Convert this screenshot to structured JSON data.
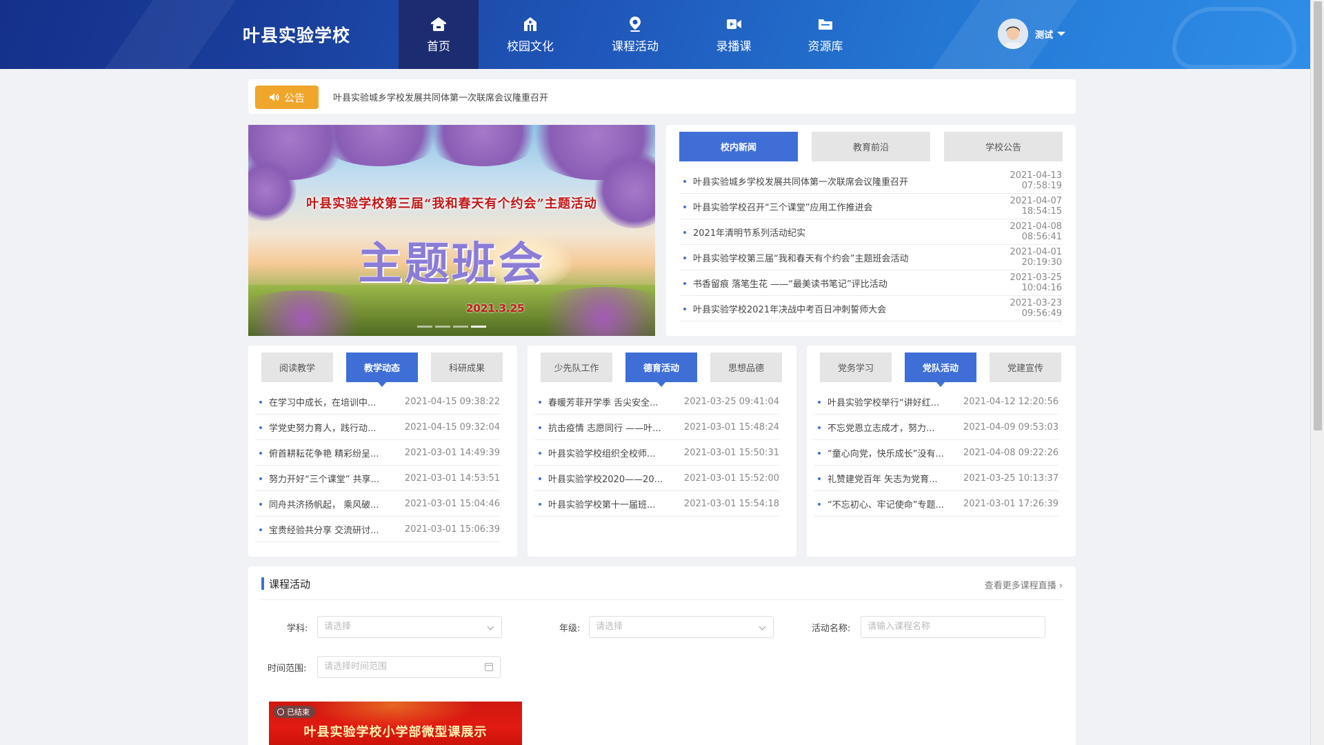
{
  "header": {
    "brand": "叶县实验学校",
    "user_name": "测试",
    "nav": [
      {
        "label": "首页",
        "icon": "home-icon",
        "active": true
      },
      {
        "label": "校园文化",
        "icon": "school-icon",
        "active": false
      },
      {
        "label": "课程活动",
        "icon": "location-pin-icon",
        "active": false
      },
      {
        "label": "录播课",
        "icon": "video-camera-icon",
        "active": false
      },
      {
        "label": "资源库",
        "icon": "folder-icon",
        "active": false
      }
    ]
  },
  "notice": {
    "badge": "公告",
    "text": "叶县实验城乡学校发展共同体第一次联席会议隆重召开"
  },
  "banner": {
    "title": "叶县实验学校第三届“我和春天有个约会”主题活动",
    "main": "主题班会",
    "date": "2021.3.25"
  },
  "news": {
    "tabs": [
      "校内新闻",
      "教育前沿",
      "学校公告"
    ],
    "items": [
      {
        "title": "叶县实验城乡学校发展共同体第一次联席会议隆重召开",
        "date": "2021-04-13 07:58:19"
      },
      {
        "title": "叶县实验学校召开“三个课堂”应用工作推进会",
        "date": "2021-04-07 18:54:15"
      },
      {
        "title": "2021年清明节系列活动纪实",
        "date": "2021-04-08 08:56:41"
      },
      {
        "title": "叶县实验学校第三届“我和春天有个约会”主题班会活动",
        "date": "2021-04-01 20:19:30"
      },
      {
        "title": "书香留痕 落笔生花 ——“最美读书笔记”评比活动",
        "date": "2021-03-25 10:04:16"
      },
      {
        "title": "叶县实验学校2021年决战中考百日冲刺誓师大会",
        "date": "2021-03-23 09:56:49"
      }
    ]
  },
  "columns": [
    {
      "tabs": [
        "阅读教学",
        "教学动态",
        "科研成果"
      ],
      "active": 1,
      "items": [
        {
          "title": "在学习中成长，在培训中...",
          "date": "2021-04-15 09:38:22"
        },
        {
          "title": "学党史努力育人，践行动...",
          "date": "2021-04-15 09:32:04"
        },
        {
          "title": "俯首耕耘花争艳 精彩纷呈...",
          "date": "2021-03-01 14:49:39"
        },
        {
          "title": "努力开好“三个课堂” 共享...",
          "date": "2021-03-01 14:53:51"
        },
        {
          "title": "同舟共济扬帆起， 乘风破...",
          "date": "2021-03-01 15:04:46"
        },
        {
          "title": "宝贵经验共分享 交流研讨...",
          "date": "2021-03-01 15:06:39"
        }
      ]
    },
    {
      "tabs": [
        "少先队工作",
        "德育活动",
        "思想品德"
      ],
      "active": 1,
      "items": [
        {
          "title": "春暖芳菲开学季 舌尖安全...",
          "date": "2021-03-25 09:41:04"
        },
        {
          "title": "抗击疫情 志愿同行 ——叶...",
          "date": "2021-03-01 15:48:24"
        },
        {
          "title": "叶县实验学校组织全校师...",
          "date": "2021-03-01 15:50:31"
        },
        {
          "title": "叶县实验学校2020——20...",
          "date": "2021-03-01 15:52:00"
        },
        {
          "title": "叶县实验学校第十一届班...",
          "date": "2021-03-01 15:54:18"
        }
      ]
    },
    {
      "tabs": [
        "党务学习",
        "党队活动",
        "党建宣传"
      ],
      "active": 1,
      "items": [
        {
          "title": "叶县实验学校举行“讲好红...",
          "date": "2021-04-12 12:20:56"
        },
        {
          "title": "不忘党恩立志成才，努力...",
          "date": "2021-04-09 09:53:03"
        },
        {
          "title": "“童心向党，快乐成长”没有...",
          "date": "2021-04-08 09:22:26"
        },
        {
          "title": "礼赞建党百年 矢志为党育...",
          "date": "2021-03-25 10:13:37"
        },
        {
          "title": "“不忘初心、牢记使命”专题...",
          "date": "2021-03-01 17:26:39"
        }
      ]
    }
  ],
  "course": {
    "title": "课程活动",
    "more": "查看更多课程直播 ›",
    "subject_label": "学科:",
    "subject_placeholder": "请选择",
    "grade_label": "年级:",
    "grade_placeholder": "请选择",
    "name_label": "活动名称:",
    "name_placeholder": "请输入课程名称",
    "time_label": "时间范围:",
    "time_placeholder": "请选择时间范围",
    "card_badge": "已结束",
    "card_title": "叶县实验学校小学部微型课展示"
  }
}
